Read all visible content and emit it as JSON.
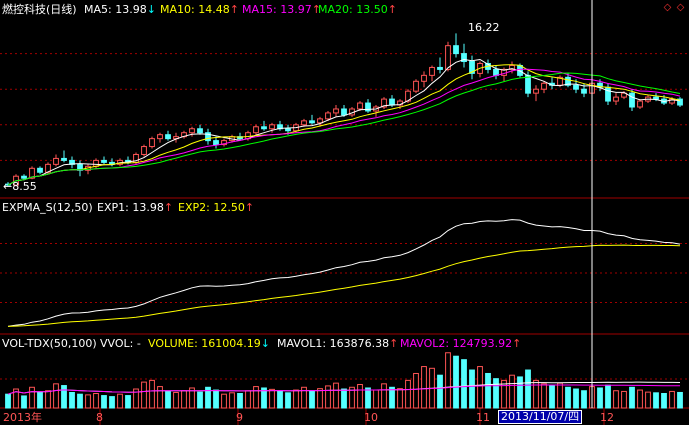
{
  "main_panel": {
    "title": "燃控科技(日线)",
    "indicators": [
      {
        "label": "MA5: 13.98",
        "arrow": "↓",
        "color": "#ffffff"
      },
      {
        "label": "MA10: 14.48",
        "arrow": "↑",
        "color": "#ffff00"
      },
      {
        "label": "MA15: 13.97",
        "arrow": "↑",
        "color": "#ff00ff"
      },
      {
        "label": "MA20: 13.50",
        "arrow": "↑",
        "color": "#00ff00"
      }
    ],
    "high_label": "16.22",
    "low_label": "←8.55",
    "window_buttons": [
      "◇",
      "◇"
    ]
  },
  "expma_panel": {
    "title": "EXPMA_S(12,50)",
    "indicators": [
      {
        "label": "EXP1: 13.98",
        "arrow": "↑",
        "color": "#ffffff"
      },
      {
        "label": "EXP2: 12.50",
        "arrow": "↑",
        "color": "#ffff00"
      }
    ]
  },
  "vol_panel": {
    "title": "VOL-TDX(50,100)",
    "vvol": "VVOL: -",
    "indicators": [
      {
        "label": "VOLUME: 161004.19",
        "arrow": "↓",
        "color": "#ffff00"
      },
      {
        "label": "MAVOL1: 163876.38",
        "arrow": "↑",
        "color": "#ffffff"
      },
      {
        "label": "MAVOL2: 124793.92",
        "arrow": "↑",
        "color": "#ff00ff"
      }
    ]
  },
  "time_axis": {
    "labels": [
      "2013年",
      "8",
      "9",
      "10",
      "11",
      "12"
    ],
    "cursor_date": "2013/11/07/四"
  },
  "colors": {
    "up": "#ff5555",
    "down": "#54ffff",
    "grid": "#a00000",
    "cursor": "#ffffff"
  },
  "chart_data": {
    "type": "candlestick",
    "price_range": [
      8.0,
      17.0
    ],
    "candles": [
      [
        8.6,
        8.7,
        8.5,
        8.55
      ],
      [
        8.55,
        9.1,
        8.5,
        9.0
      ],
      [
        9.0,
        9.1,
        8.8,
        8.9
      ],
      [
        8.9,
        9.5,
        8.85,
        9.4
      ],
      [
        9.4,
        9.5,
        9.1,
        9.2
      ],
      [
        9.2,
        9.7,
        9.1,
        9.6
      ],
      [
        9.6,
        10.1,
        9.5,
        9.9
      ],
      [
        9.9,
        10.3,
        9.7,
        9.8
      ],
      [
        9.8,
        10.0,
        9.4,
        9.6
      ],
      [
        9.6,
        9.8,
        9.0,
        9.3
      ],
      [
        9.3,
        9.6,
        9.1,
        9.5
      ],
      [
        9.5,
        9.9,
        9.4,
        9.8
      ],
      [
        9.8,
        10.0,
        9.6,
        9.7
      ],
      [
        9.7,
        9.9,
        9.5,
        9.6
      ],
      [
        9.6,
        9.9,
        9.5,
        9.8
      ],
      [
        9.8,
        10.0,
        9.6,
        9.7
      ],
      [
        9.7,
        10.2,
        9.6,
        10.1
      ],
      [
        10.1,
        10.6,
        10.0,
        10.5
      ],
      [
        10.5,
        11.0,
        10.4,
        10.9
      ],
      [
        10.9,
        11.2,
        10.7,
        11.1
      ],
      [
        11.1,
        11.3,
        10.8,
        10.9
      ],
      [
        10.9,
        11.2,
        10.7,
        11.0
      ],
      [
        11.0,
        11.3,
        10.9,
        11.2
      ],
      [
        11.2,
        11.5,
        11.0,
        11.4
      ],
      [
        11.4,
        11.6,
        11.1,
        11.2
      ],
      [
        11.2,
        11.4,
        10.6,
        10.8
      ],
      [
        10.8,
        11.0,
        10.4,
        10.6
      ],
      [
        10.6,
        10.9,
        10.5,
        10.8
      ],
      [
        10.8,
        11.1,
        10.7,
        11.0
      ],
      [
        11.0,
        11.2,
        10.8,
        10.9
      ],
      [
        10.9,
        11.3,
        10.8,
        11.2
      ],
      [
        11.2,
        11.6,
        11.1,
        11.5
      ],
      [
        11.5,
        11.8,
        11.3,
        11.4
      ],
      [
        11.4,
        11.7,
        11.2,
        11.6
      ],
      [
        11.6,
        11.8,
        11.3,
        11.4
      ],
      [
        11.4,
        11.6,
        11.1,
        11.3
      ],
      [
        11.3,
        11.7,
        11.2,
        11.6
      ],
      [
        11.6,
        11.9,
        11.5,
        11.8
      ],
      [
        11.8,
        12.1,
        11.6,
        11.7
      ],
      [
        11.7,
        12.0,
        11.5,
        11.9
      ],
      [
        11.9,
        12.3,
        11.8,
        12.2
      ],
      [
        12.2,
        12.6,
        12.0,
        12.4
      ],
      [
        12.4,
        12.6,
        12.0,
        12.1
      ],
      [
        12.1,
        12.5,
        12.0,
        12.4
      ],
      [
        12.4,
        12.8,
        12.3,
        12.7
      ],
      [
        12.7,
        12.9,
        12.2,
        12.3
      ],
      [
        12.3,
        12.6,
        12.0,
        12.5
      ],
      [
        12.5,
        13.0,
        12.4,
        12.9
      ],
      [
        12.9,
        13.1,
        12.5,
        12.6
      ],
      [
        12.6,
        12.9,
        12.4,
        12.8
      ],
      [
        12.8,
        13.4,
        12.7,
        13.3
      ],
      [
        13.3,
        13.9,
        13.2,
        13.8
      ],
      [
        13.8,
        14.3,
        13.5,
        14.1
      ],
      [
        14.1,
        14.6,
        13.8,
        14.5
      ],
      [
        14.5,
        15.0,
        14.2,
        14.4
      ],
      [
        14.4,
        15.8,
        14.3,
        15.6
      ],
      [
        15.6,
        16.22,
        15.0,
        15.2
      ],
      [
        15.2,
        15.7,
        14.5,
        14.8
      ],
      [
        14.8,
        15.1,
        13.9,
        14.2
      ],
      [
        14.2,
        14.8,
        14.0,
        14.7
      ],
      [
        14.7,
        14.9,
        14.2,
        14.4
      ],
      [
        14.4,
        14.6,
        13.9,
        14.1
      ],
      [
        14.1,
        14.5,
        13.8,
        14.4
      ],
      [
        14.4,
        14.8,
        14.2,
        14.6
      ],
      [
        14.6,
        14.7,
        14.0,
        14.1
      ],
      [
        14.1,
        14.3,
        13.0,
        13.2
      ],
      [
        13.2,
        13.6,
        12.8,
        13.4
      ],
      [
        13.4,
        13.8,
        13.2,
        13.7
      ],
      [
        13.7,
        14.0,
        13.4,
        13.6
      ],
      [
        13.6,
        14.1,
        13.5,
        14.0
      ],
      [
        14.0,
        14.2,
        13.5,
        13.6
      ],
      [
        13.6,
        13.9,
        13.2,
        13.4
      ],
      [
        13.4,
        13.7,
        13.0,
        13.2
      ],
      [
        13.2,
        13.8,
        13.1,
        13.7
      ],
      [
        13.7,
        13.9,
        13.3,
        13.5
      ],
      [
        13.5,
        13.7,
        12.6,
        12.8
      ],
      [
        12.8,
        13.2,
        12.6,
        13.0
      ],
      [
        13.0,
        13.3,
        12.9,
        13.2
      ],
      [
        13.2,
        13.4,
        12.3,
        12.5
      ],
      [
        12.5,
        12.9,
        12.4,
        12.8
      ],
      [
        12.8,
        13.1,
        12.7,
        13.0
      ],
      [
        13.0,
        13.2,
        12.8,
        12.9
      ],
      [
        12.9,
        13.1,
        12.6,
        12.7
      ],
      [
        12.7,
        13.0,
        12.6,
        12.9
      ],
      [
        12.9,
        13.0,
        12.5,
        12.6
      ]
    ],
    "volume": [
      40,
      55,
      35,
      60,
      45,
      50,
      70,
      65,
      45,
      40,
      38,
      42,
      36,
      33,
      40,
      36,
      55,
      75,
      80,
      62,
      48,
      45,
      50,
      58,
      46,
      60,
      52,
      40,
      44,
      42,
      50,
      62,
      58,
      54,
      48,
      44,
      52,
      60,
      50,
      56,
      64,
      72,
      55,
      60,
      68,
      58,
      52,
      70,
      60,
      56,
      80,
      100,
      120,
      115,
      95,
      160,
      150,
      140,
      110,
      120,
      100,
      85,
      80,
      95,
      90,
      110,
      80,
      70,
      65,
      72,
      60,
      55,
      50,
      62,
      58,
      66,
      50,
      48,
      60,
      52,
      46,
      44,
      42,
      48,
      45
    ],
    "cursor_index": 73
  }
}
